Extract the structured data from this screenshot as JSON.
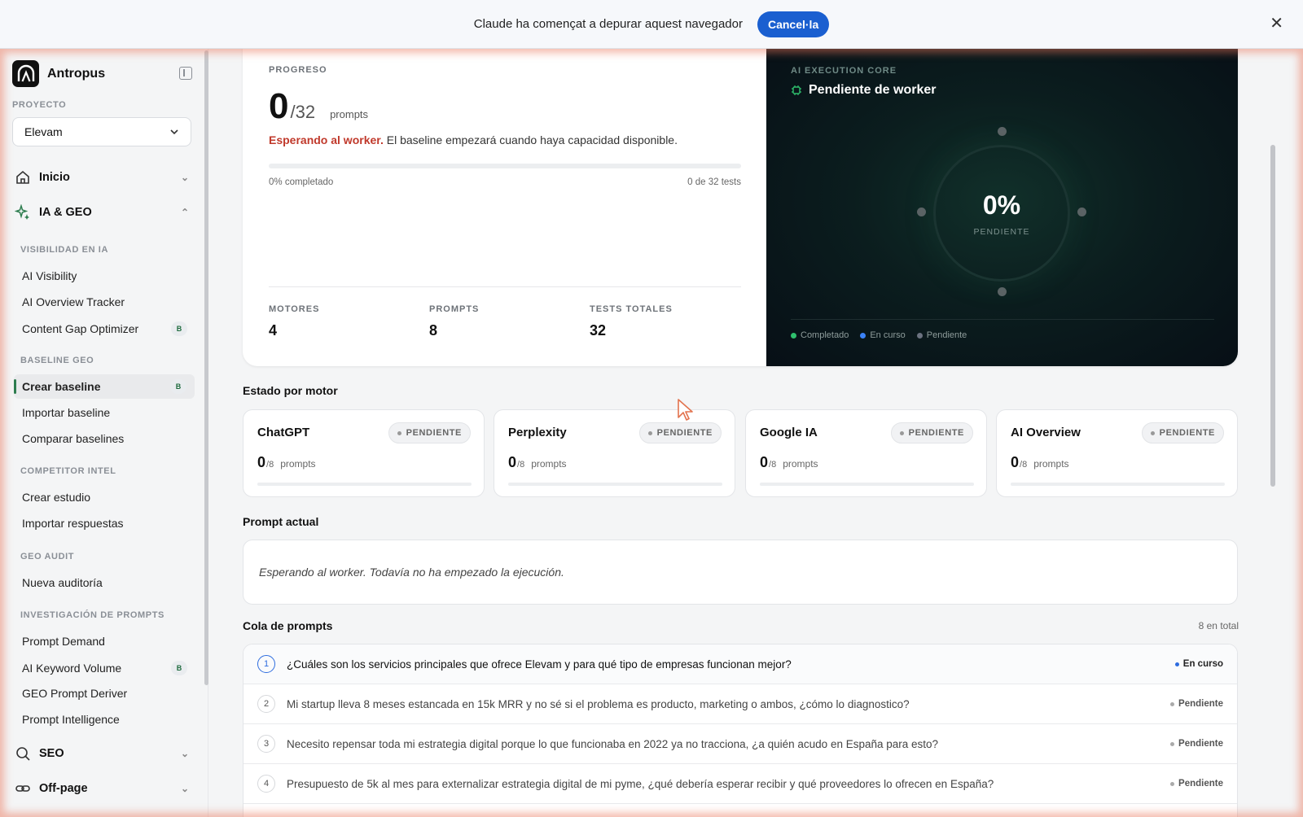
{
  "debug_bar": {
    "message": "Claude ha començat a depurar aquest navegador",
    "cancel_label": "Cancel·la"
  },
  "sidebar": {
    "brand": "Antropus",
    "project_label": "PROYECTO",
    "project_value": "Elevam",
    "nav": {
      "inicio": "Inicio",
      "ia_geo": "IA & GEO",
      "seo": "SEO",
      "offpage": "Off-page"
    },
    "sections": {
      "visibilidad": "VISIBILIDAD EN IA",
      "baseline": "BASELINE GEO",
      "competitor": "COMPETITOR INTEL",
      "audit": "GEO AUDIT",
      "prompts": "INVESTIGACIÓN DE PROMPTS"
    },
    "items": {
      "ai_visibility": "AI Visibility",
      "ai_overview_tracker": "AI Overview Tracker",
      "content_gap": "Content Gap Optimizer",
      "crear_baseline": "Crear baseline",
      "importar_baseline": "Importar baseline",
      "comparar_baselines": "Comparar baselines",
      "crear_estudio": "Crear estudio",
      "importar_respuestas": "Importar respuestas",
      "nueva_auditoria": "Nueva auditoría",
      "prompt_demand": "Prompt Demand",
      "ai_keyword_volume": "AI Keyword Volume",
      "geo_prompt_deriver": "GEO Prompt Deriver",
      "prompt_intelligence": "Prompt Intelligence"
    },
    "beta_badge": "B"
  },
  "progress": {
    "caption": "PROGRESO",
    "done": "0",
    "total": "/32",
    "unit": "prompts",
    "waiting_strong": "Esperando al worker.",
    "waiting_text": " El baseline empezará cuando haya capacidad disponible.",
    "percent_fraction": 0,
    "completed_label": "0% completado",
    "tests_label": "0 de 32 tests",
    "stats": {
      "motores_label": "MOTORES",
      "motores_value": "4",
      "prompts_label": "PROMPTS",
      "prompts_value": "8",
      "tests_label": "TESTS TOTALES",
      "tests_value": "32"
    }
  },
  "core": {
    "caption": "AI EXECUTION CORE",
    "title": "Pendiente de worker",
    "percent": "0%",
    "status": "PENDIENTE",
    "legend": {
      "completado": "Completado",
      "en_curso": "En curso",
      "pendiente": "Pendiente"
    },
    "colors": {
      "completado": "#2fbf6d",
      "en_curso": "#3b82f6",
      "pendiente": "#6b7280"
    }
  },
  "engines_title": "Estado por motor",
  "engines": [
    {
      "name": "ChatGPT",
      "status": "PENDIENTE",
      "done": "0",
      "total": "/8",
      "unit": "prompts"
    },
    {
      "name": "Perplexity",
      "status": "PENDIENTE",
      "done": "0",
      "total": "/8",
      "unit": "prompts"
    },
    {
      "name": "Google IA",
      "status": "PENDIENTE",
      "done": "0",
      "total": "/8",
      "unit": "prompts"
    },
    {
      "name": "AI Overview",
      "status": "PENDIENTE",
      "done": "0",
      "total": "/8",
      "unit": "prompts"
    }
  ],
  "current_prompt": {
    "title": "Prompt actual",
    "text": "Esperando al worker. Todavía no ha empezado la ejecución."
  },
  "queue": {
    "title": "Cola de prompts",
    "total_label": "8 en total",
    "rows": [
      {
        "num": "1",
        "text": "¿Cuáles son los servicios principales que ofrece Elevam y para qué tipo de empresas funcionan mejor?",
        "status": "En curso"
      },
      {
        "num": "2",
        "text": "Mi startup lleva 8 meses estancada en 15k MRR y no sé si el problema es producto, marketing o ambos, ¿cómo lo diagnostico?",
        "status": "Pendiente"
      },
      {
        "num": "3",
        "text": "Necesito repensar toda mi estrategia digital porque lo que funcionaba en 2022 ya no tracciona, ¿a quién acudo en España para esto?",
        "status": "Pendiente"
      },
      {
        "num": "4",
        "text": "Presupuesto de 5k al mes para externalizar estrategia digital de mi pyme, ¿qué debería esperar recibir y qué proveedores lo ofrecen en España?",
        "status": "Pendiente"
      }
    ]
  }
}
